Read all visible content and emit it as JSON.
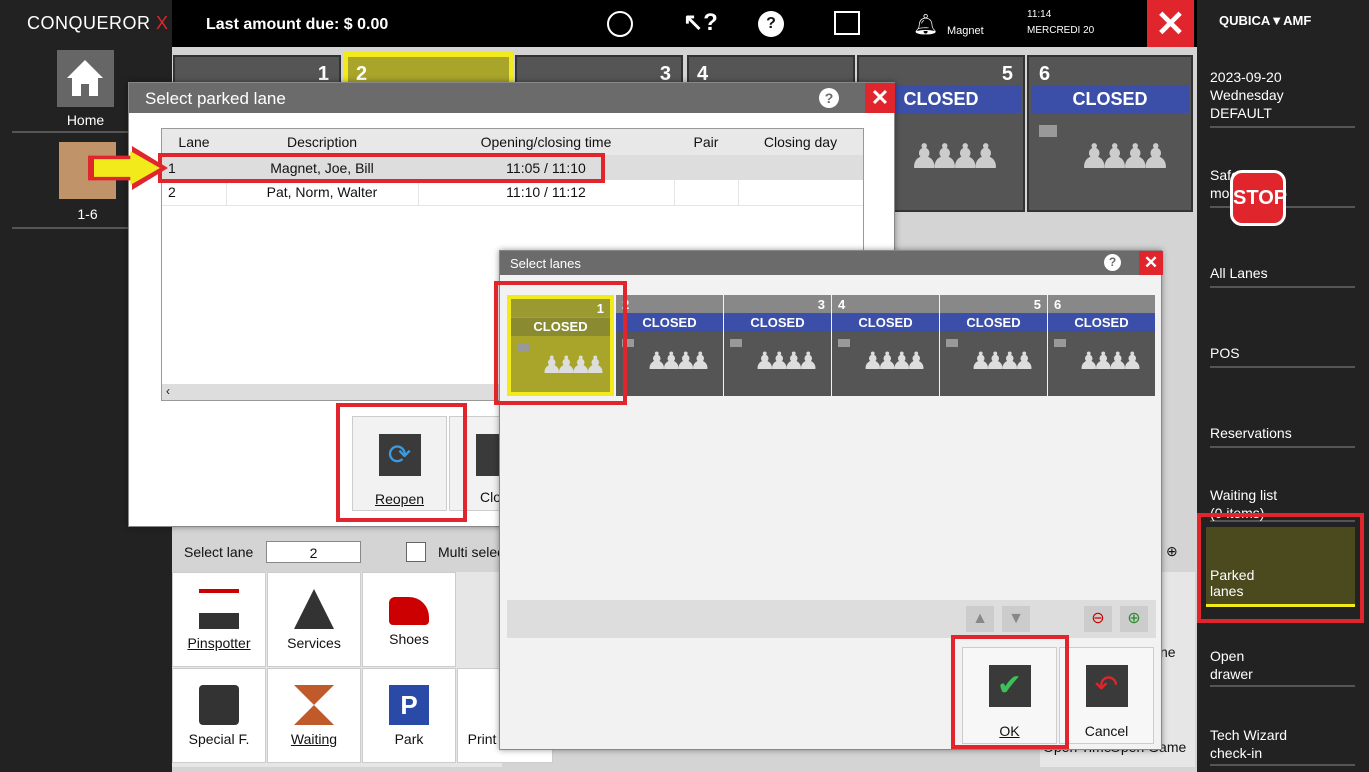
{
  "app": {
    "brand": "CONQUEROR",
    "brand_x": "X",
    "last_amount": "Last amount due: $ 0.00",
    "user": "Magnet",
    "time": "11:14",
    "date": "MERCREDI 20",
    "vendor": "QUBICA▼AMF"
  },
  "left": {
    "home": "Home",
    "lanes": "1-6"
  },
  "right": {
    "date": "2023-09-20",
    "day": "Wednesday",
    "profile": "DEFAULT",
    "safe": "Safe",
    "safe2": "mo",
    "stop": "STOP",
    "all_lanes": "All Lanes",
    "pos": "POS",
    "reservations": "Reservations",
    "waiting": "Waiting list",
    "waiting_count": "(0 items)",
    "parked": "Parked",
    "parked2": "lanes",
    "open_drawer": "Open",
    "open_drawer2": "drawer",
    "tech": "Tech Wizard",
    "tech2": "check-in"
  },
  "bg_lanes": [
    {
      "num": "1"
    },
    {
      "num": "2"
    },
    {
      "num": "3"
    },
    {
      "num": "4"
    },
    {
      "num": "5",
      "status": "CLOSED"
    },
    {
      "num": "6",
      "status": "CLOSED"
    }
  ],
  "parked_dialog": {
    "title": "Select parked lane",
    "columns": [
      "Lane",
      "Description",
      "Opening/closing time",
      "Pair",
      "Closing day"
    ],
    "rows": [
      [
        "1",
        "Magnet, Joe, Bill",
        "11:05 / 11:10",
        "",
        ""
      ],
      [
        "2",
        "Pat, Norm, Walter",
        "11:10 / 11:12",
        "",
        ""
      ]
    ],
    "reopen": "Reopen",
    "close": "Clo"
  },
  "bottom": {
    "select_lane_label": "Select lane",
    "select_lane_value": "2",
    "multi": "Multi select",
    "buttons": [
      "Pinspotter",
      "Services",
      "Shoes",
      "Special F.",
      "Waiting",
      "Park",
      "Print games"
    ],
    "right_labels": [
      "ne",
      "Open Time",
      "Open Game"
    ]
  },
  "lanes_dialog": {
    "title": "Select lanes",
    "lanes": [
      {
        "num": "1",
        "status": "CLOSED"
      },
      {
        "num": "2",
        "status": "CLOSED"
      },
      {
        "num": "3",
        "status": "CLOSED"
      },
      {
        "num": "4",
        "status": "CLOSED"
      },
      {
        "num": "5",
        "status": "CLOSED"
      },
      {
        "num": "6",
        "status": "CLOSED"
      }
    ],
    "ok": "OK",
    "cancel": "Cancel"
  },
  "colors": {
    "accent_red": "#e0262c",
    "highlight_yellow": "#f2ea1a",
    "closed_blue": "#3b4fa8",
    "parked_olive": "#4a4a1e"
  }
}
